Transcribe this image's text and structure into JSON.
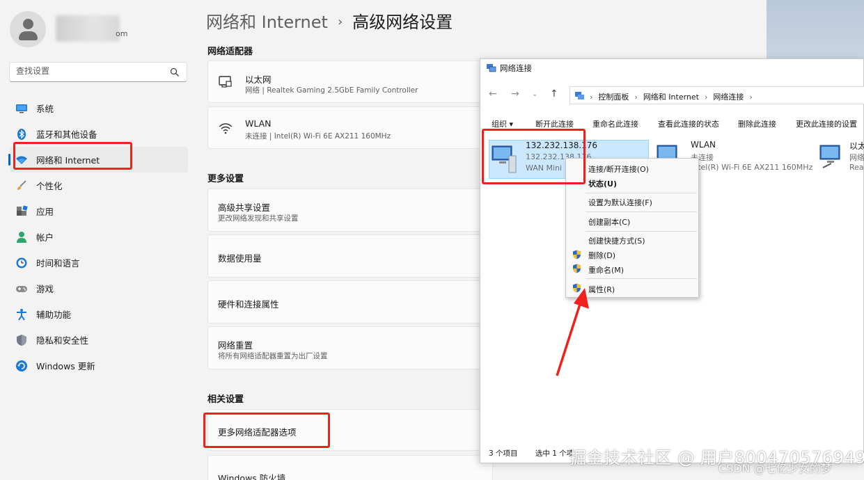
{
  "settings": {
    "account_suffix": "om",
    "search": {
      "placeholder": "查找设置"
    },
    "nav": [
      {
        "label": "系统",
        "icon": "display-icon"
      },
      {
        "label": "蓝牙和其他设备",
        "icon": "bluetooth-icon"
      },
      {
        "label": "网络和 Internet",
        "icon": "wifi-icon",
        "active": true
      },
      {
        "label": "个性化",
        "icon": "brush-icon"
      },
      {
        "label": "应用",
        "icon": "apps-icon"
      },
      {
        "label": "帐户",
        "icon": "person-icon"
      },
      {
        "label": "时间和语言",
        "icon": "globe-clock-icon"
      },
      {
        "label": "游戏",
        "icon": "gamepad-icon"
      },
      {
        "label": "辅助功能",
        "icon": "accessibility-icon"
      },
      {
        "label": "隐私和安全性",
        "icon": "shield-icon"
      },
      {
        "label": "Windows 更新",
        "icon": "update-icon"
      }
    ],
    "breadcrumb": {
      "parent": "网络和 Internet",
      "separator": "›",
      "current": "高级网络设置"
    },
    "adapters_title": "网络适配器",
    "adapters": [
      {
        "name": "以太网",
        "detail": "网络 | Realtek Gaming 2.5GbE Family Controller",
        "icon": "ethernet-icon"
      },
      {
        "name": "WLAN",
        "detail": "未连接 | Intel(R) Wi-Fi 6E AX211 160MHz",
        "icon": "wifi-icon"
      }
    ],
    "more_title": "更多设置",
    "more": [
      {
        "title": "高级共享设置",
        "sub": "更改网络发现和共享设置"
      },
      {
        "title": "数据使用量",
        "sub": ""
      },
      {
        "title": "硬件和连接属性",
        "sub": ""
      },
      {
        "title": "网络重置",
        "sub": "将所有网络适配器重置为出厂设置"
      }
    ],
    "related_title": "相关设置",
    "related": [
      {
        "title": "更多网络适配器选项"
      },
      {
        "title": "Windows 防火墙"
      }
    ]
  },
  "netwin": {
    "title": "网络连接",
    "path": [
      "控制面板",
      "网络和 Internet",
      "网络连接"
    ],
    "commands": [
      "组织 ▾",
      "断开此连接",
      "重命名此连接",
      "查看此连接的状态",
      "删除此连接",
      "更改此连接的设置"
    ],
    "connections": [
      {
        "l1": "132.232.138.176",
        "l2": "132.232.138.176",
        "l3": "WAN Mini"
      },
      {
        "l1": "WLAN",
        "l2": "未连接",
        "l3": "Intel(R) Wi-Fi 6E AX211 160MHz"
      },
      {
        "l1": "以太",
        "l2": "网络",
        "l3": "Rea"
      }
    ],
    "status": {
      "count": "3 个项目",
      "selected": "选中 1 个项"
    }
  },
  "context_menu": [
    {
      "label": "连接/断开连接(O)",
      "bold": false,
      "shield": false
    },
    {
      "label": "状态(U)",
      "bold": true,
      "shield": false
    },
    {
      "label": "设置为默认连接(F)",
      "bold": false,
      "shield": false
    },
    {
      "label": "创建副本(C)",
      "bold": false,
      "shield": false
    },
    {
      "label": "创建快捷方式(S)",
      "bold": false,
      "shield": false
    },
    {
      "label": "删除(D)",
      "bold": false,
      "shield": true
    },
    {
      "label": "重命名(M)",
      "bold": false,
      "shield": true
    },
    {
      "label": "属性(R)",
      "bold": false,
      "shield": true
    }
  ],
  "watermark": {
    "main": "掘金技术社区 @ 用户800470576949",
    "csdn": "CSDN @七亿少女的梦"
  },
  "colors": {
    "accent": "#0067c0",
    "annotation": "#f0201c",
    "selection": "#cce8ff"
  }
}
